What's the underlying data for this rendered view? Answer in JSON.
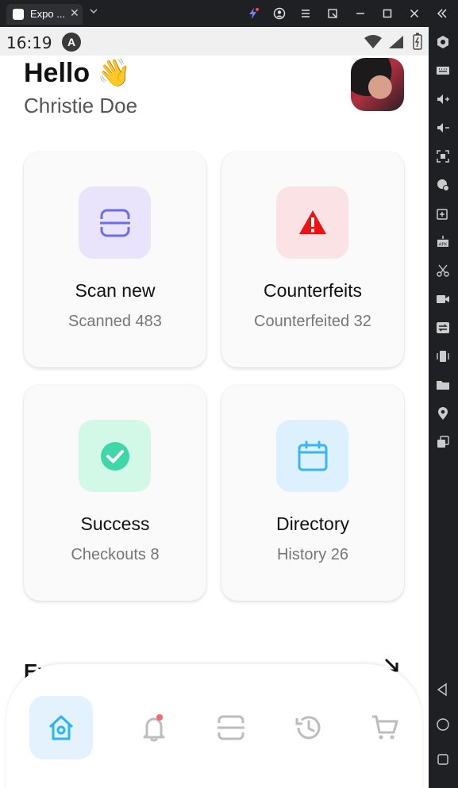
{
  "window": {
    "tab_title": "Expo ...",
    "close_glyph": "✕"
  },
  "status": {
    "time": "16:19",
    "badge": "A"
  },
  "header": {
    "greeting": "Hello 👋",
    "name": "Christie Doe"
  },
  "cards": [
    {
      "title": "Scan new",
      "subtitle": "Scanned 483",
      "icon": "scan-icon",
      "bg": "#e9e3fb",
      "color": "#6c6cf0"
    },
    {
      "title": "Counterfeits",
      "subtitle": "Counterfeited 32",
      "icon": "warning-icon",
      "bg": "#fbe3e5",
      "color": "#ee1111"
    },
    {
      "title": "Success",
      "subtitle": "Checkouts 8",
      "icon": "check-circle-icon",
      "bg": "#d2f8e8",
      "color": "#3fd6a8"
    },
    {
      "title": "Directory",
      "subtitle": "History 26",
      "icon": "calendar-icon",
      "bg": "#dcf1fd",
      "color": "#39b6f3"
    }
  ],
  "section": {
    "title": "Ex"
  },
  "nav": [
    {
      "icon": "home-icon",
      "active": true
    },
    {
      "icon": "bell-icon",
      "active": false
    },
    {
      "icon": "scan-icon",
      "active": false
    },
    {
      "icon": "history-icon",
      "active": false
    },
    {
      "icon": "cart-icon",
      "active": false
    }
  ],
  "colors": {
    "accent": "#29b6f6",
    "inactive_icon": "#bdbdbd",
    "notification_dot": "#f46a6a"
  }
}
